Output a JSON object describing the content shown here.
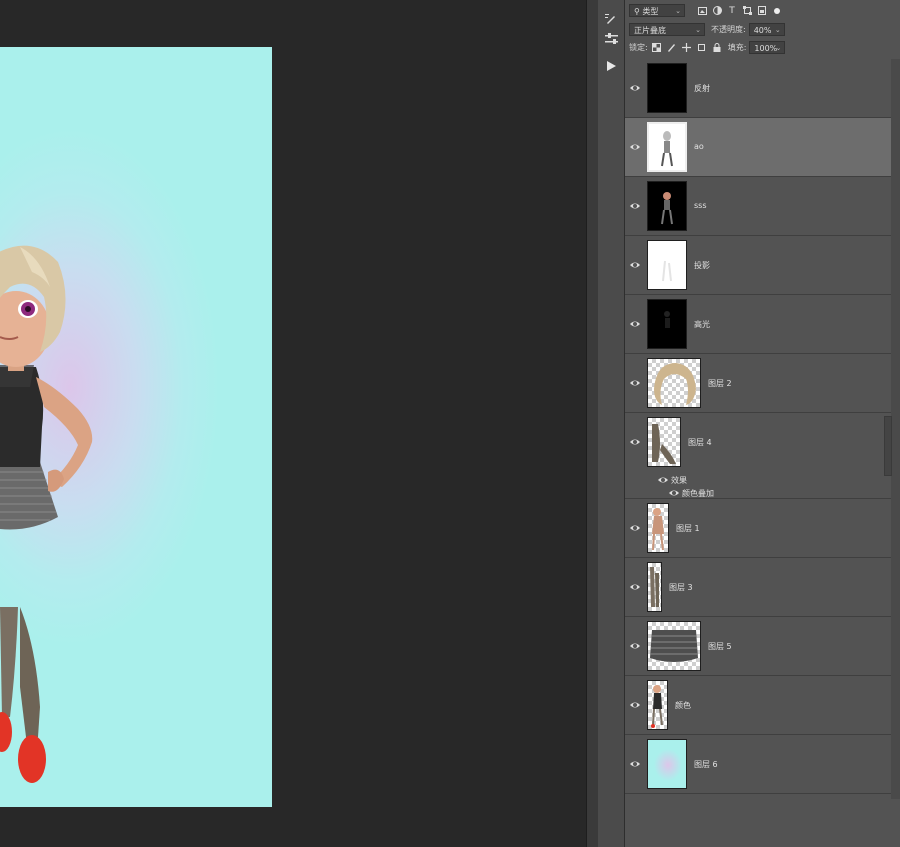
{
  "panel": {
    "filter_label": "类型",
    "blend_mode": "正片叠底",
    "opacity_label": "不透明度:",
    "opacity_value": "40%",
    "lock_label": "锁定:",
    "fill_label": "填充:",
    "fill_value": "100%"
  },
  "layers": [
    {
      "name": "反射",
      "thumb": "black"
    },
    {
      "name": "ao",
      "thumb": "white-figure",
      "selected": true
    },
    {
      "name": "sss",
      "thumb": "dark-figure"
    },
    {
      "name": "投影",
      "thumb": "white"
    },
    {
      "name": "高光",
      "thumb": "black-faint"
    },
    {
      "name": "图层 2",
      "thumb": "hair"
    },
    {
      "name": "图层 4",
      "thumb": "legs",
      "fx": "fx",
      "effects_label": "效果",
      "effect": "颜色叠加"
    },
    {
      "name": "图层 1",
      "thumb": "body"
    },
    {
      "name": "图层 3",
      "thumb": "legs2"
    },
    {
      "name": "图层 5",
      "thumb": "skirt"
    },
    {
      "name": "颜色",
      "thumb": "color-figure"
    },
    {
      "name": "图层 6",
      "thumb": "gradient"
    }
  ],
  "colors": {
    "panel_bg": "#535353",
    "selected_row": "#6d6d6d",
    "canvas_bg": "#282828",
    "doc_teal": "#aaf0ec",
    "doc_lilac": "#dcc6ea"
  }
}
